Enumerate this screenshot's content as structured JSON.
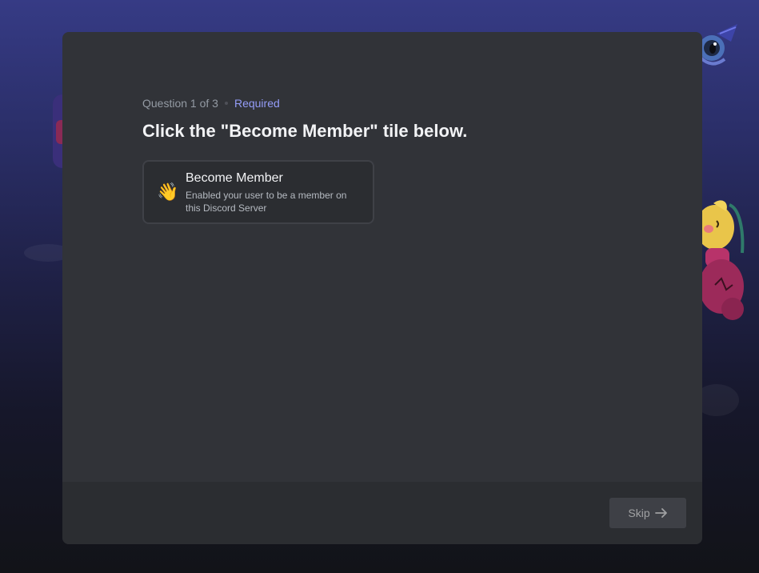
{
  "onboarding": {
    "progress": "Question 1 of 3",
    "required_label": "Required",
    "question": "Click the \"Become Member\" tile below.",
    "options": [
      {
        "emoji": "👋",
        "title": "Become Member",
        "description": "Enabled your user to be a member on this Discord Server"
      }
    ]
  },
  "footer": {
    "skip_label": "Skip",
    "skip_icon": "arrow-right-icon"
  },
  "colors": {
    "accent": "#949cf7",
    "modal_bg": "#313338",
    "footer_bg": "#2b2d31"
  }
}
